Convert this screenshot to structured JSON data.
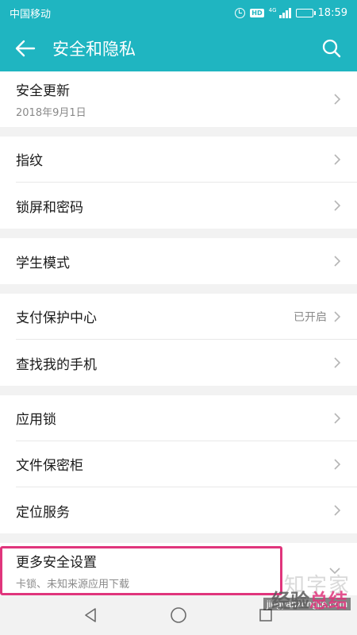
{
  "status_bar": {
    "carrier": "中国移动",
    "hd": "HD",
    "network": "4G",
    "time": "18:59"
  },
  "app_bar": {
    "title": "安全和隐私"
  },
  "groups": [
    {
      "rows": [
        {
          "title": "安全更新",
          "subtitle": "2018年9月1日",
          "status": ""
        }
      ]
    },
    {
      "rows": [
        {
          "title": "指纹",
          "status": ""
        },
        {
          "title": "锁屏和密码",
          "status": ""
        }
      ]
    },
    {
      "rows": [
        {
          "title": "学生模式",
          "status": ""
        }
      ]
    },
    {
      "rows": [
        {
          "title": "支付保护中心",
          "status": "已开启"
        },
        {
          "title": "查找我的手机",
          "status": ""
        }
      ]
    },
    {
      "rows": [
        {
          "title": "应用锁",
          "status": ""
        },
        {
          "title": "文件保密柜",
          "status": ""
        },
        {
          "title": "定位服务",
          "status": ""
        }
      ]
    },
    {
      "rows": [
        {
          "title": "更多安全设置",
          "subtitle": "卡锁、未知来源应用下载",
          "status": ""
        }
      ]
    }
  ],
  "watermark": {
    "logo": "知字家",
    "brand_a": "经验",
    "brand_b": "总结",
    "url": "jingyanzongjie.com"
  },
  "colors": {
    "accent": "#1fb5c1",
    "highlight": "#e0357c"
  }
}
